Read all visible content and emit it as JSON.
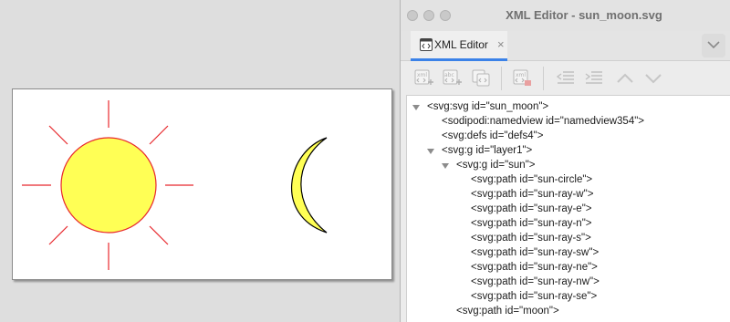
{
  "window": {
    "title": "XML Editor - sun_moon.svg"
  },
  "tabs": [
    {
      "label": "XML Editor",
      "close": "×"
    }
  ],
  "toolbar": {
    "buttons": [
      "new-element-node-icon",
      "new-text-node-icon",
      "duplicate-node-icon",
      "delete-node-icon",
      "unindent-node-icon",
      "indent-node-icon",
      "raise-node-icon",
      "lower-node-icon"
    ]
  },
  "tree": {
    "nodes": [
      {
        "text": "<svg:svg id=\"sun_moon\">",
        "expanded": true
      },
      {
        "text": "<sodipodi:namedview id=\"namedview354\">"
      },
      {
        "text": "<svg:defs id=\"defs4\">"
      },
      {
        "text": "<svg:g id=\"layer1\">",
        "expanded": true
      },
      {
        "text": "<svg:g id=\"sun\">",
        "expanded": true
      },
      {
        "text": "<svg:path id=\"sun-circle\">"
      },
      {
        "text": "<svg:path id=\"sun-ray-w\">"
      },
      {
        "text": "<svg:path id=\"sun-ray-e\">"
      },
      {
        "text": "<svg:path id=\"sun-ray-n\">"
      },
      {
        "text": "<svg:path id=\"sun-ray-s\">"
      },
      {
        "text": "<svg:path id=\"sun-ray-sw\">"
      },
      {
        "text": "<svg:path id=\"sun-ray-ne\">"
      },
      {
        "text": "<svg:path id=\"sun-ray-nw\">"
      },
      {
        "text": "<svg:path id=\"sun-ray-se\">"
      },
      {
        "text": "<svg:path id=\"moon\">"
      }
    ]
  },
  "canvas": {
    "sun_fill": "#ffff55",
    "sun_stroke": "#e8282d",
    "moon_fill": "#ffff55",
    "moon_stroke": "#000000"
  },
  "colors": {
    "accent": "#3b82e8"
  }
}
